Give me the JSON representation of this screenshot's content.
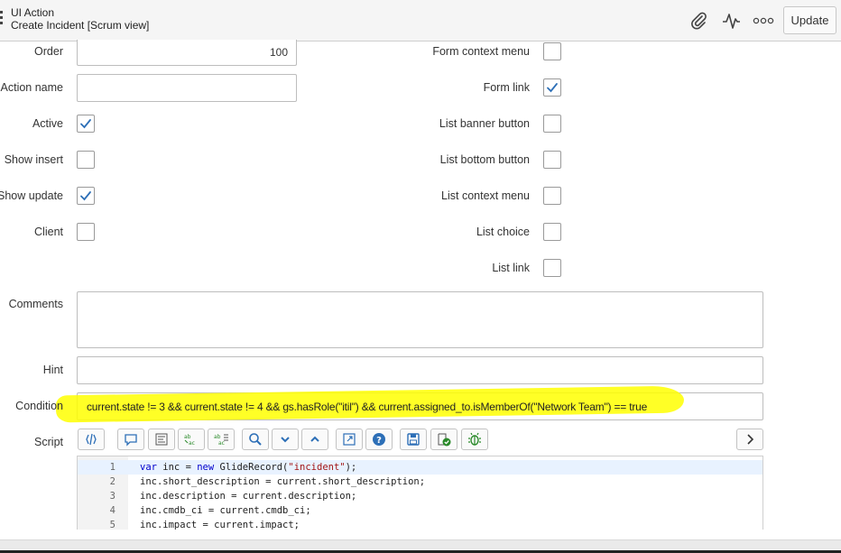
{
  "header": {
    "title": "UI Action",
    "subtitle": "Create Incident [Scrum view]",
    "icons": [
      "paperclip-icon",
      "activity-icon",
      "more-options-icon"
    ],
    "update_label": "Update"
  },
  "form": {
    "left": {
      "order_label": "Order",
      "order_value": "100",
      "action_name_label": "Action name",
      "action_name_value": "",
      "active_label": "Active",
      "active_checked": true,
      "show_insert_label": "Show insert",
      "show_insert_checked": false,
      "show_update_label": "Show update",
      "show_update_checked": true,
      "client_label": "Client",
      "client_checked": false
    },
    "right": {
      "form_context_menu_label": "Form context menu",
      "form_context_menu_checked": false,
      "form_link_label": "Form link",
      "form_link_checked": true,
      "list_banner_button_label": "List banner button",
      "list_banner_button_checked": false,
      "list_bottom_button_label": "List bottom button",
      "list_bottom_button_checked": false,
      "list_context_menu_label": "List context menu",
      "list_context_menu_checked": false,
      "list_choice_label": "List choice",
      "list_choice_checked": false,
      "list_link_label": "List link",
      "list_link_checked": false
    },
    "comments_label": "Comments",
    "hint_label": "Hint",
    "condition_label": "Condition",
    "condition_value": "current.state != 3 && current.state != 4 && gs.hasRole(\"itil\") && current.assigned_to.isMemberOf(\"Network Team\") == true",
    "highlight_color": "#ffff00",
    "script_label": "Script"
  },
  "toolbar": {
    "icons": [
      "toggle-syntax-icon",
      "comment-icon",
      "format-code-icon",
      "replace-icon",
      "replace-all-icon",
      "search-icon",
      "collapse-icon",
      "expand-icon",
      "fullscreen-icon",
      "help-icon",
      "save-icon",
      "script-check-icon",
      "debug-icon"
    ],
    "next_icon": "chevron-right-icon"
  },
  "code": {
    "lines": [
      {
        "n": "1",
        "text": "var inc = new GlideRecord(\"incident\");"
      },
      {
        "n": "2",
        "text": "inc.short_description = current.short_description;"
      },
      {
        "n": "3",
        "text": "inc.description = current.description;"
      },
      {
        "n": "4",
        "text": "inc.cmdb_ci = current.cmdb_ci;"
      },
      {
        "n": "5",
        "text": "inc.impact = current.impact;"
      }
    ]
  }
}
